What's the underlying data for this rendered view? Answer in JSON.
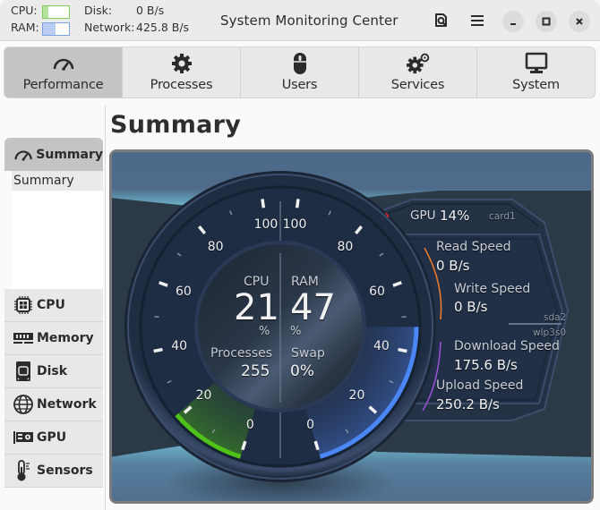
{
  "header": {
    "cpu_label": "CPU:",
    "ram_label": "RAM:",
    "cpu_bar_fraction": 0.21,
    "ram_bar_fraction": 0.47,
    "disk_label": "Disk:",
    "disk_value": "0 B/s",
    "network_label": "Network:",
    "network_value": "425.8 B/s",
    "title": "System Monitoring Center",
    "icons": [
      "report-search-icon",
      "hamburger-menu-icon"
    ],
    "window_buttons": [
      "minimize",
      "maximize",
      "close"
    ]
  },
  "tabs": [
    {
      "label": "Performance",
      "icon": "speedometer-icon",
      "active": true
    },
    {
      "label": "Processes",
      "icon": "gear-icon",
      "active": false
    },
    {
      "label": "Users",
      "icon": "mouse-icon",
      "active": false
    },
    {
      "label": "Services",
      "icon": "gears-icon",
      "active": false
    },
    {
      "label": "System",
      "icon": "monitor-icon",
      "active": false
    }
  ],
  "sidebar": {
    "header": {
      "label": "Summary",
      "icon": "speedometer-icon"
    },
    "list": [
      "Summary"
    ],
    "categories": [
      {
        "label": "CPU",
        "icon": "cpu-chip-icon"
      },
      {
        "label": "Memory",
        "icon": "memory-module-icon"
      },
      {
        "label": "Disk",
        "icon": "disk-drive-icon"
      },
      {
        "label": "Network",
        "icon": "globe-icon"
      },
      {
        "label": "GPU",
        "icon": "graphics-card-icon"
      },
      {
        "label": "Sensors",
        "icon": "thermometer-icon"
      }
    ]
  },
  "main": {
    "title": "Summary"
  },
  "dashboard": {
    "cpu": {
      "label": "CPU",
      "value": "21",
      "unit": "%",
      "percent": 21
    },
    "ram": {
      "label": "RAM",
      "value": "47",
      "unit": "%",
      "percent": 47
    },
    "processes": {
      "label": "Processes",
      "value": "255"
    },
    "swap": {
      "label": "Swap",
      "value": "0%"
    },
    "scale_labels": [
      "0",
      "20",
      "40",
      "60",
      "80",
      "100"
    ],
    "gpu": {
      "label": "GPU",
      "value": "14%",
      "device": "card1",
      "percent": 14
    },
    "disk": {
      "device": "sda2",
      "read_label": "Read Speed",
      "read_value": "0 B/s",
      "write_label": "Write Speed",
      "write_value": "0 B/s"
    },
    "network": {
      "device": "wlp3s0",
      "download_label": "Download Speed",
      "download_value": "175.6 B/s",
      "upload_label": "Upload Speed",
      "upload_value": "250.2 B/s"
    },
    "colors": {
      "cpu_arc": "#4fc21a",
      "ram_arc": "#4a86f5",
      "gpu_mark": "#e0252b",
      "disk_arc": "#e8782b",
      "network_arc": "#9b4fd6"
    }
  }
}
